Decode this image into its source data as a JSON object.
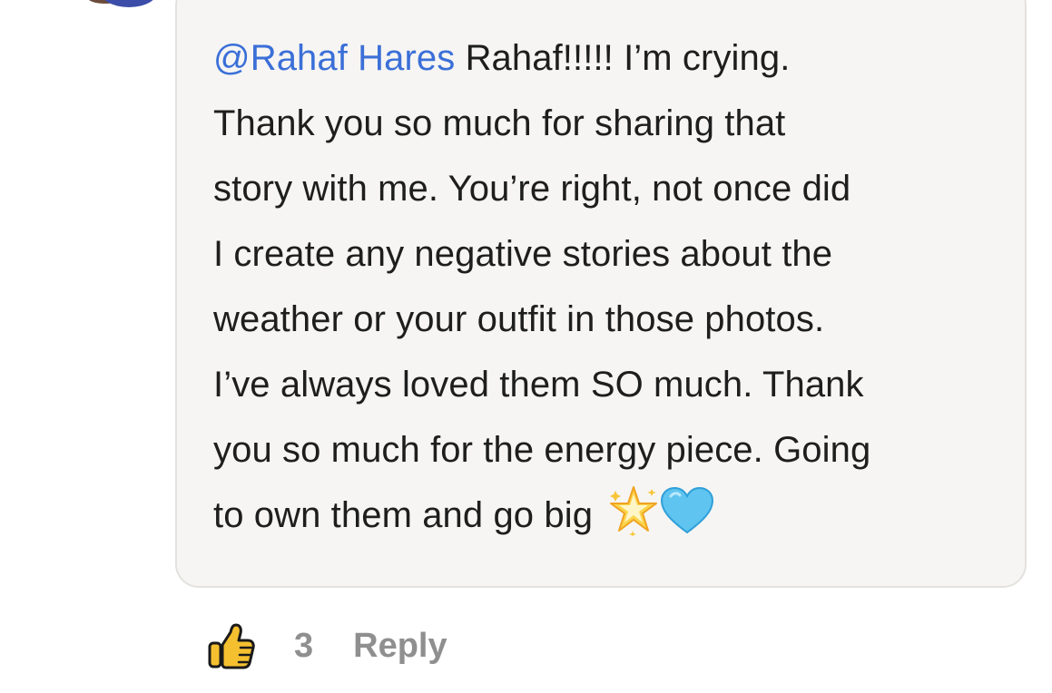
{
  "comment": {
    "mention": "@Rahaf Hares",
    "first_line_rest": " Rahaf!!!!! I’m crying.",
    "lines": [
      "Thank you so much for sharing that",
      "story with me. You’re right, not once did",
      "I create any negative stories about the",
      "weather or your outfit in those photos.",
      "I’ve always loved them SO much. Thank",
      "you so much for the energy piece. Going"
    ],
    "last_line": "to own them and go big ",
    "emojis": [
      "glowing-star",
      "light-blue-heart"
    ]
  },
  "actions": {
    "like_count": "3",
    "reply_label": "Reply"
  },
  "colors": {
    "mention": "#3b6fd8",
    "bubble_background": "#f6f5f3",
    "action_text": "#8f8f8f",
    "thumb": "#f5c030"
  }
}
